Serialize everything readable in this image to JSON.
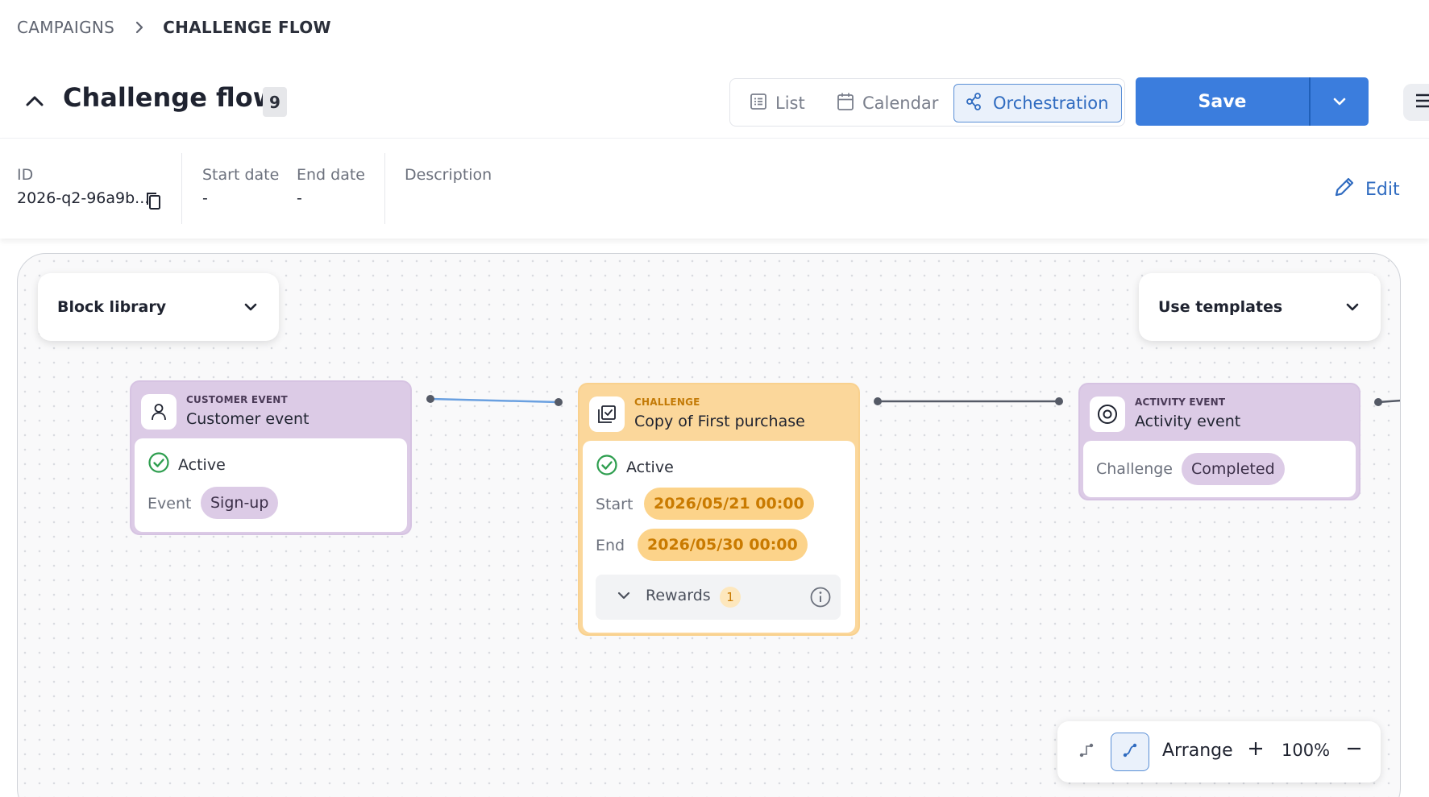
{
  "breadcrumb": {
    "root": "CAMPAIGNS",
    "current": "CHALLENGE FLOW"
  },
  "header": {
    "title": "Challenge flow",
    "count": "9"
  },
  "view_switch": {
    "list": "List",
    "calendar": "Calendar",
    "orchestration": "Orchestration",
    "active": "Orchestration"
  },
  "actions": {
    "save": "Save"
  },
  "meta": {
    "id_label": "ID",
    "id_value": "2026-q2-96a9b...",
    "start_label": "Start date",
    "start_value": "-",
    "end_label": "End date",
    "end_value": "-",
    "description_label": "Description",
    "edit_label": "Edit"
  },
  "canvas": {
    "block_library": "Block library",
    "use_templates": "Use templates",
    "nodes": {
      "customer": {
        "type": "CUSTOMER EVENT",
        "title": "Customer event",
        "status": "Active",
        "field_label": "Event",
        "field_value": "Sign-up"
      },
      "challenge": {
        "type": "CHALLENGE",
        "title": "Copy of First purchase",
        "status": "Active",
        "start_label": "Start",
        "start_value": "2026/05/21 00:00",
        "end_label": "End",
        "end_value": "2026/05/30 00:00",
        "rewards_label": "Rewards",
        "rewards_count": "1"
      },
      "activity": {
        "type": "ACTIVITY EVENT",
        "title": "Activity event",
        "field_label": "Challenge",
        "field_value": "Completed"
      }
    },
    "toolbar": {
      "arrange": "Arrange",
      "zoom": "100%"
    }
  },
  "colors": {
    "primary": "#3b7ddd",
    "event_node": "#dccbe6",
    "challenge_node": "#fbd79b",
    "success": "#2e9e4f",
    "accent_text": "#c97a00"
  },
  "icons": {
    "collapse": "chevron-up-icon",
    "list": "list-icon",
    "calendar": "calendar-icon",
    "orchestration": "flow-icon",
    "copy": "copy-icon",
    "edit": "pencil-icon",
    "customer": "person-icon",
    "challenge": "checklist-icon",
    "activity": "target-icon",
    "status": "check-circle-icon",
    "info": "info-icon",
    "menu": "hamburger-icon"
  }
}
